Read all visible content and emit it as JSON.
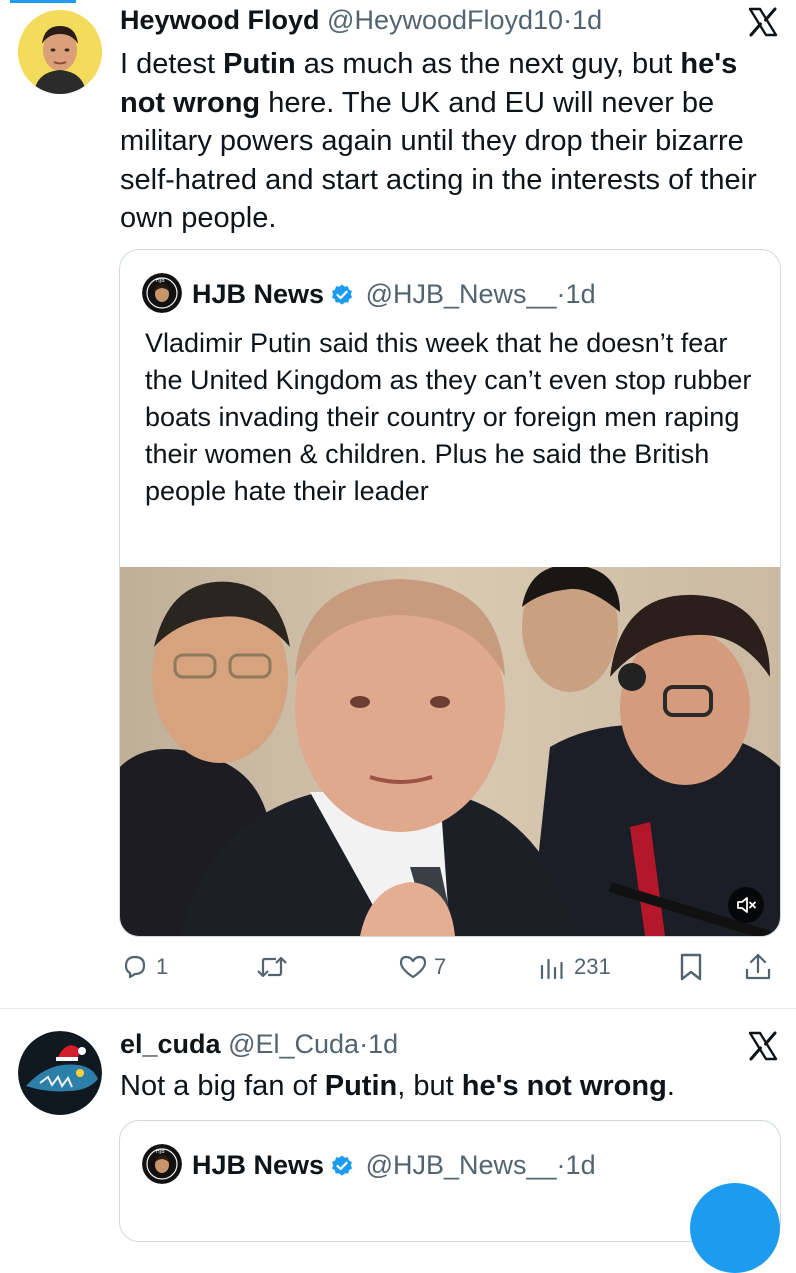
{
  "tweet1": {
    "name": "Heywood Floyd",
    "handle": "@HeywoodFloyd10",
    "sep": "·",
    "time": "1d",
    "text_parts": {
      "p1": "I detest ",
      "b1": "Putin",
      "p2": " as much as the next guy, but ",
      "b2": "he's not wrong",
      "p3": " here. The UK and EU will never be military powers again until they drop their bizarre self-hatred and start acting in the interests of their own people."
    },
    "quote": {
      "name": "HJB News",
      "handle": "@HJB_News__",
      "sep": "·",
      "time": "1d",
      "text": "Vladimir Putin said this week that he doesn’t fear the United Kingdom as they can’t even stop rubber boats invading their country or foreign men raping their women & children. Plus he said the British people hate their leader"
    },
    "actions": {
      "replies": "1",
      "retweets": "",
      "likes": "7",
      "views": "231"
    }
  },
  "tweet2": {
    "name": "el_cuda",
    "handle": "@El_Cuda",
    "sep": "·",
    "time": "1d",
    "text_parts": {
      "p1": "Not a big fan of ",
      "b1": "Putin",
      "p2": ", but ",
      "b2": "he's not wrong",
      "p3": "."
    },
    "quote": {
      "name": "HJB News",
      "handle": "@HJB_News__",
      "sep": "·",
      "time": "1d"
    }
  },
  "icons": {
    "platform": "x-logo-icon",
    "verified": "verified-badge-icon",
    "reply": "reply-icon",
    "retweet": "retweet-icon",
    "like": "heart-icon",
    "views": "views-icon",
    "bookmark": "bookmark-icon",
    "share": "share-icon",
    "mute": "mute-icon"
  },
  "colors": {
    "accent": "#1d9bf0",
    "text": "#0f1419",
    "muted": "#536471",
    "border": "#cfd9de"
  }
}
